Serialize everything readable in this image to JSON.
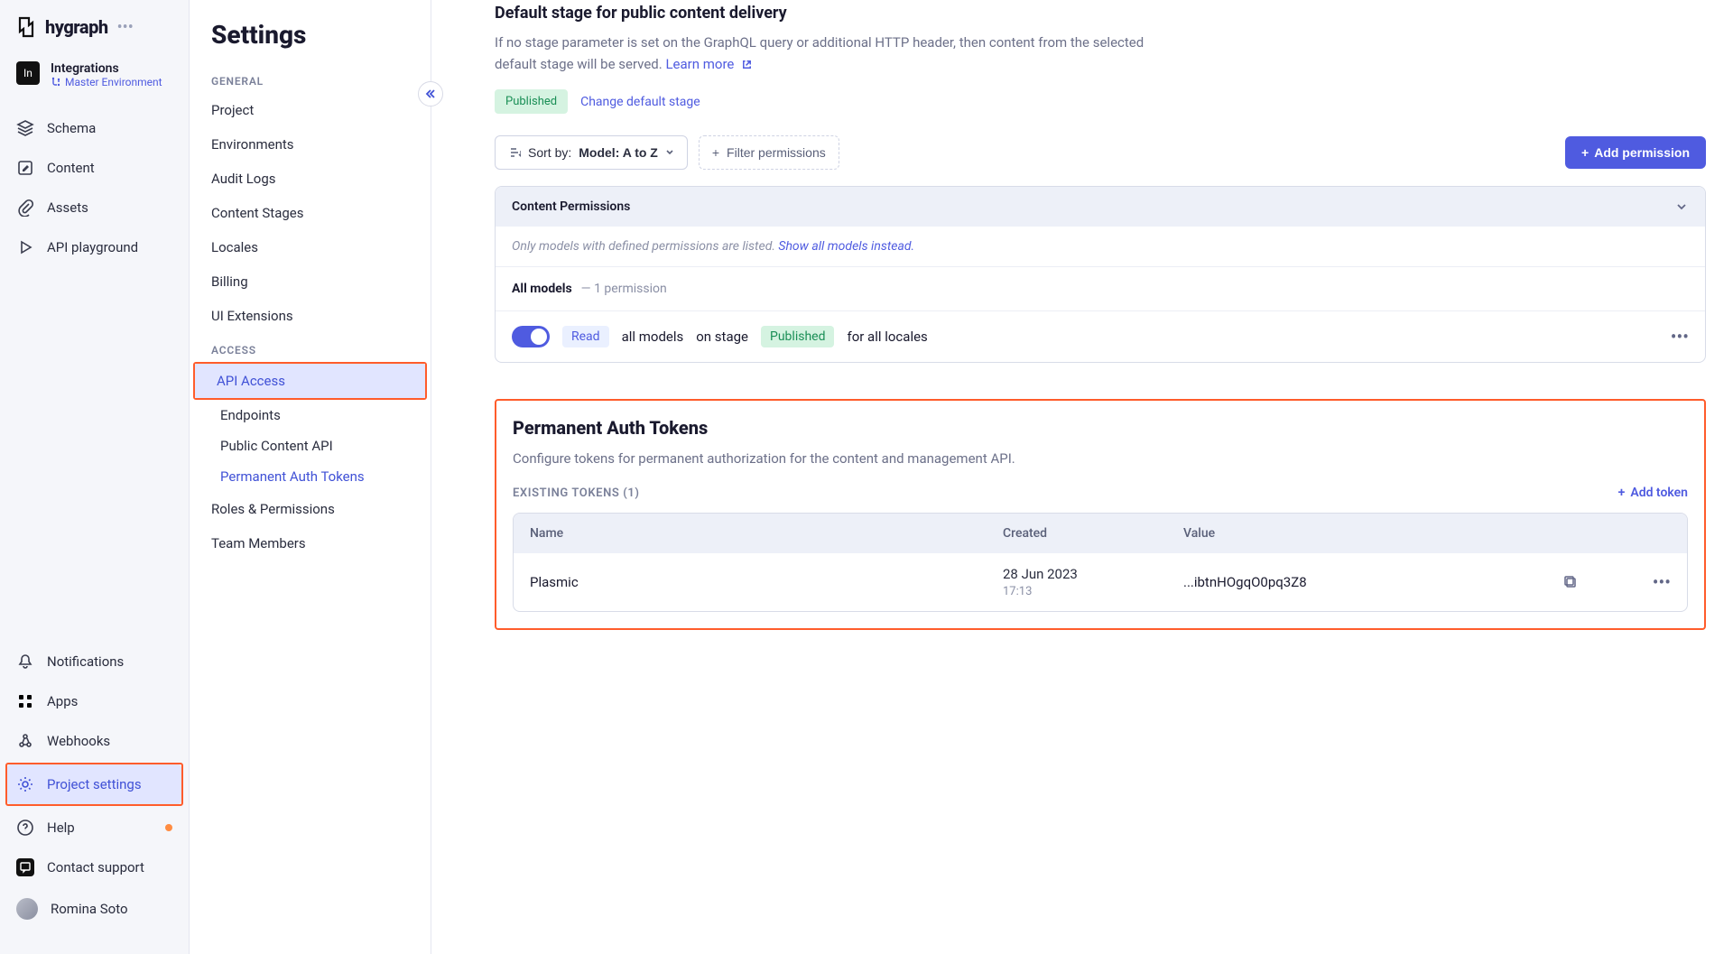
{
  "brand": {
    "name": "hygraph"
  },
  "workspace": {
    "badge": "In",
    "name": "Integrations",
    "env": "Master Environment"
  },
  "nav": {
    "schema": "Schema",
    "content": "Content",
    "assets": "Assets",
    "playground": "API playground",
    "notifications": "Notifications",
    "apps": "Apps",
    "webhooks": "Webhooks",
    "project_settings": "Project settings",
    "help": "Help",
    "contact": "Contact support",
    "user": "Romina Soto"
  },
  "settings": {
    "title": "Settings",
    "general_label": "GENERAL",
    "access_label": "ACCESS",
    "items": {
      "project": "Project",
      "environments": "Environments",
      "audit": "Audit Logs",
      "stages": "Content Stages",
      "locales": "Locales",
      "billing": "Billing",
      "extensions": "UI Extensions",
      "api_access": "API Access",
      "endpoints": "Endpoints",
      "public_api": "Public Content API",
      "tokens": "Permanent Auth Tokens",
      "roles": "Roles & Permissions",
      "team": "Team Members"
    }
  },
  "main": {
    "default_stage": {
      "title": "Default stage for public content delivery",
      "desc": "If no stage parameter is set on the GraphQL query or additional HTTP header, then content from the selected default stage will be served.",
      "learn_more": "Learn more",
      "published": "Published",
      "change": "Change default stage"
    },
    "toolbar": {
      "sort_label": "Sort by:",
      "sort_value": "Model: A to Z",
      "filter": "Filter permissions",
      "add_perm": "Add permission"
    },
    "perms": {
      "header": "Content Permissions",
      "note_prefix": "Only models with defined permissions are listed.",
      "note_link": "Show all models instead.",
      "all_models": "All models",
      "count": "— 1 permission",
      "read": "Read",
      "all_models2": "all models",
      "on_stage": "on stage",
      "pub": "Published",
      "for_locales": "for all locales"
    },
    "tokens": {
      "title": "Permanent Auth Tokens",
      "desc": "Configure tokens for permanent authorization for the content and management API.",
      "existing": "EXISTING TOKENS (1)",
      "add": "Add token",
      "cols": {
        "name": "Name",
        "created": "Created",
        "value": "Value"
      },
      "row": {
        "name": "Plasmic",
        "date": "28 Jun 2023",
        "time": "17:13",
        "value": "...ibtnHOgqO0pq3Z8"
      }
    }
  }
}
